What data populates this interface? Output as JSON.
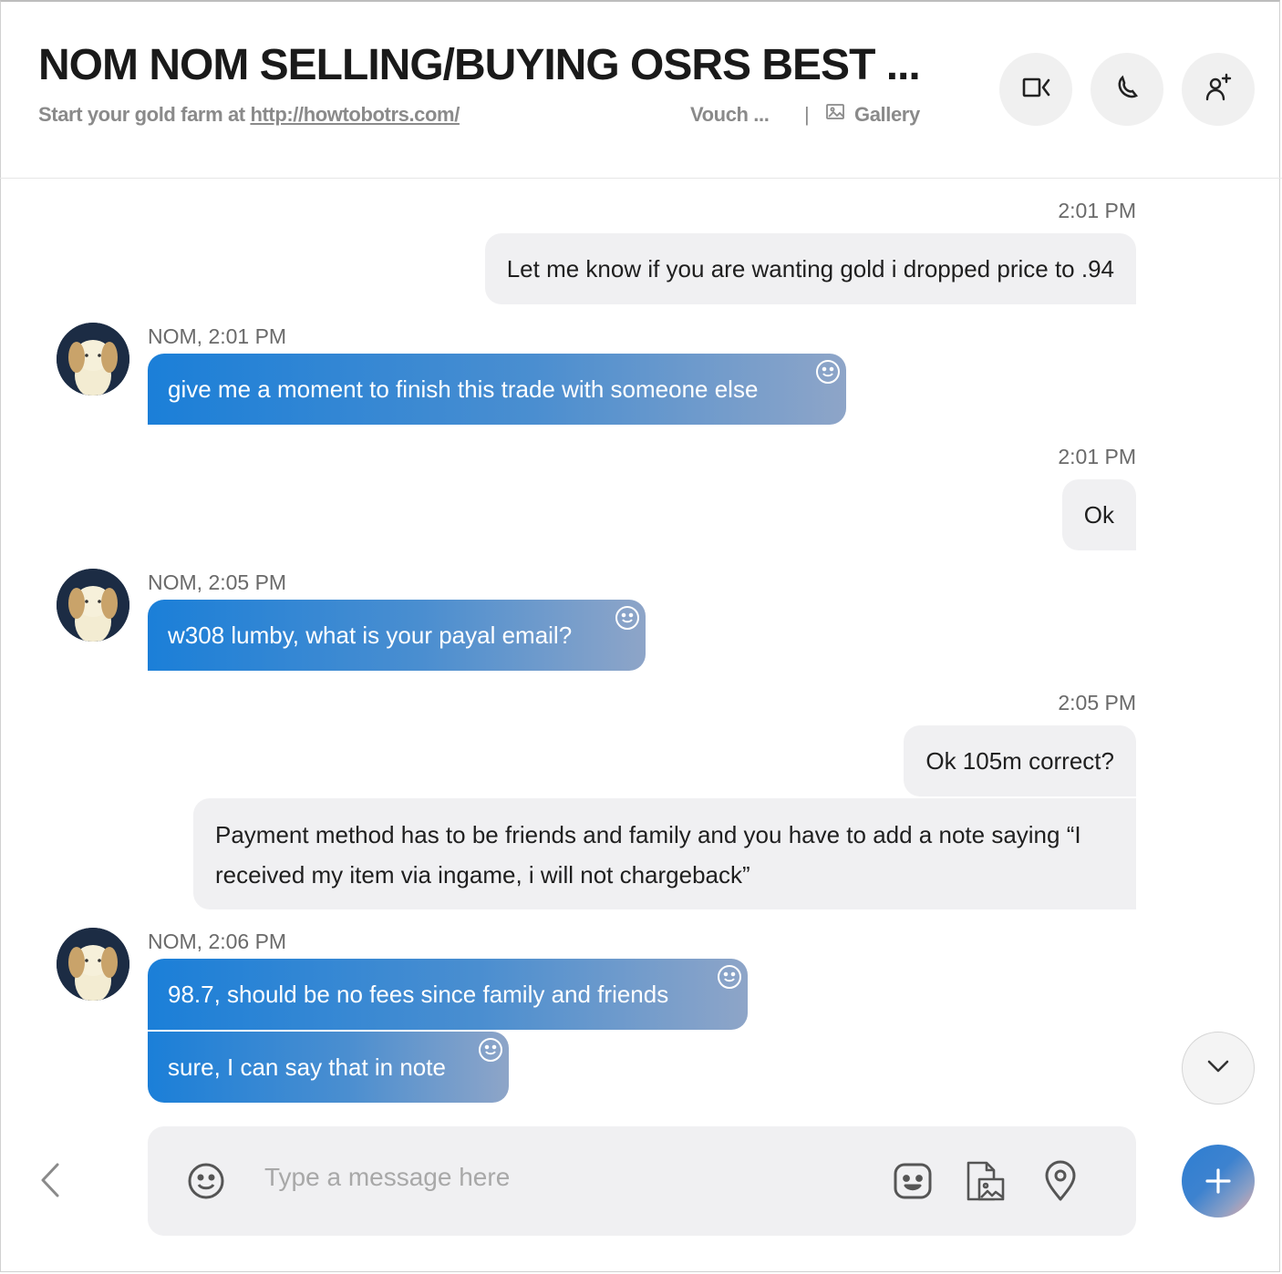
{
  "header": {
    "title": "NOM NOM SELLING/BUYING OSRS BEST ...",
    "subtitle_prefix": "Start your gold farm at ",
    "subtitle_link": "http://howtobotrs.com/",
    "vouch": "Vouch ...",
    "separator": "|",
    "gallery": "Gallery"
  },
  "messages": {
    "m1": {
      "time": "2:01 PM",
      "text": "Let me know if you are wanting gold i dropped price to .94"
    },
    "m2": {
      "sender": "NOM, 2:01 PM",
      "text": "give me a moment to finish this trade with someone else"
    },
    "m3": {
      "time": "2:01 PM",
      "text": "Ok"
    },
    "m4": {
      "sender": "NOM, 2:05 PM",
      "text": "w308 lumby, what is your payal email?"
    },
    "m5": {
      "time": "2:05 PM",
      "text": "Ok 105m correct?"
    },
    "m6": {
      "text": "Payment method has to be friends and family and you have to add a note saying “I received my item via ingame, i will not chargeback”"
    },
    "m7": {
      "sender": "NOM, 2:06 PM",
      "text": "98.7, should be no fees since family and friends"
    },
    "m8": {
      "text": "sure, I can say that in note"
    }
  },
  "composer": {
    "placeholder": "Type a message here"
  }
}
